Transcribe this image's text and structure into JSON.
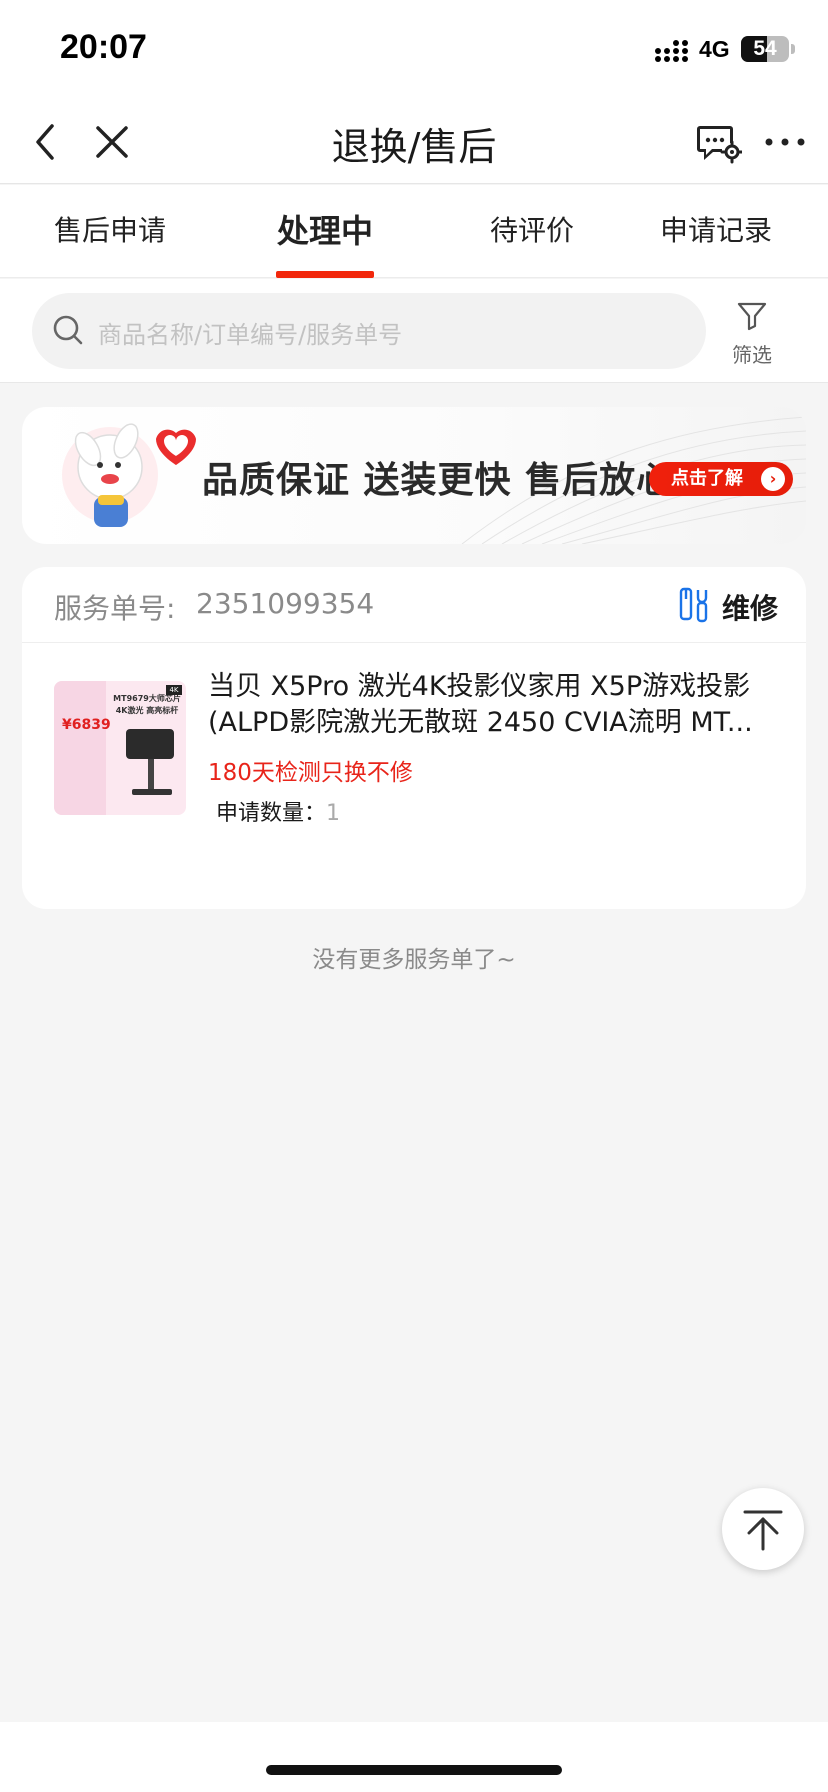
{
  "status_bar": {
    "time": "20:07",
    "network": "4G",
    "battery": "54",
    "battery_level": 0.54,
    "signal_icon": "signal-bars-icon"
  },
  "nav": {
    "title": "退换/售后",
    "back_icon": "chevron-left-icon",
    "close_icon": "close-icon",
    "message_icon": "message-settings-icon",
    "more_icon": "more-dots-icon"
  },
  "tabs": [
    {
      "label": "售后申请",
      "active": false
    },
    {
      "label": "处理中",
      "active": true
    },
    {
      "label": "待评价",
      "active": false
    },
    {
      "label": "申请记录",
      "active": false
    }
  ],
  "search": {
    "placeholder": "商品名称/订单编号/服务单号",
    "filter_label": "筛选"
  },
  "banner": {
    "slogan": "品质保证 送装更快 售后放心",
    "button_label": "点击了解",
    "button_arrow": "›"
  },
  "service_card": {
    "service_label": "服务单号:",
    "service_number": "2351099354",
    "service_type": "维修",
    "service_type_icon": "repair-tools-icon",
    "product_title_line1": "当贝 X5Pro 激光4K投影仪家用 X5P游戏投影",
    "product_title_line2": "(ALPD影院激光无散斑 2450 CVIA流明 MT...",
    "tag": "180天检测只换不修",
    "quantity_label": "申请数量：",
    "quantity_value": "1",
    "thumbnail": {
      "price": "¥6839",
      "headline_line1": "MT9679大师芯片",
      "headline_line2": "4K激光 高亮标杆",
      "badge": "4K"
    }
  },
  "footer_note": "没有更多服务单了~",
  "colors": {
    "accent": "#f2270c",
    "tag": "#e8241a",
    "repair_icon": "#1a73e8",
    "background": "#f5f5f5"
  }
}
